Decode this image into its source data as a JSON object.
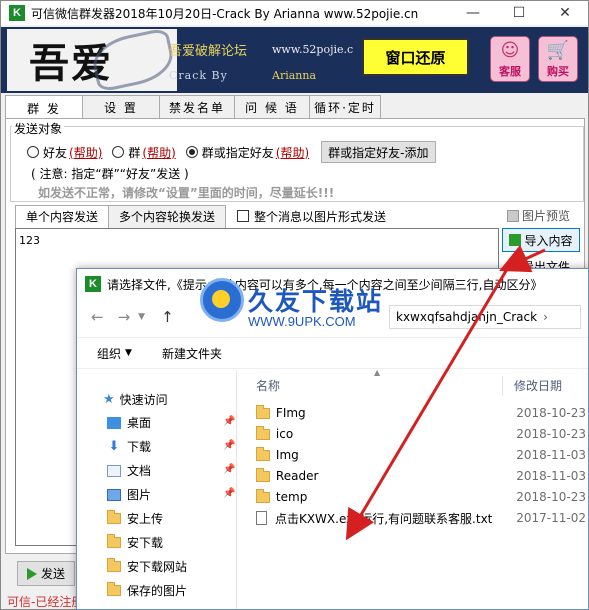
{
  "window": {
    "title": "可信微信群发器2018年10月20日-Crack By Arianna www.52pojie.cn",
    "icon_letter": "K",
    "controls": [
      "minimize-icon",
      "maximize-icon",
      "close-icon"
    ]
  },
  "banner": {
    "logo_glyph": "吾爱",
    "site_name": "吾爱破解论坛",
    "url": "www.52pojie.c",
    "crack_by": "Crack By",
    "author": "Arianna",
    "restore_button": "窗口还原",
    "service_button": "客服",
    "buy_button": "购买"
  },
  "tabs": [
    "群 发",
    "设 置",
    "禁发名单",
    "问 候 语",
    "循环·定时"
  ],
  "active_tab": 0,
  "send_target": {
    "group_label": "发送对象",
    "options": [
      {
        "label": "好友",
        "help": "(帮助)",
        "selected": false
      },
      {
        "label": "群",
        "help": "(帮助)",
        "selected": false
      },
      {
        "label": "群或指定好友",
        "help": "(帮助)",
        "selected": true
      }
    ],
    "add_button": "群或指定好友-添加",
    "note": "( 注意: 指定“群”“好友”发送 )",
    "warning": "如发送不正常，请修改“设置”里面的时间，尽量延长!!!"
  },
  "content": {
    "subtabs": [
      "单个内容发送",
      "多个内容轮换发送"
    ],
    "checkbox_label": "整个消息以图片形式发送",
    "text_value": "123",
    "preview_label": "图片预览",
    "import_button": "导入内容",
    "export_button": "导出文件"
  },
  "bottom": {
    "send_button": "发送",
    "status": "可信-已经注册"
  },
  "dialog": {
    "icon_letter": "K",
    "title": "请选择文件,《提示:文件内容可以有多个,每一个内容之间至少间隔三行,自动区分》",
    "address": "kxwxqfsahdjanjn_Crack",
    "organize": "组织",
    "new_folder": "新建文件夹",
    "quick_access": "快速访问",
    "nav_items": [
      "桌面",
      "下载",
      "文档",
      "图片",
      "安上传",
      "安下载",
      "安下载网站",
      "保存的图片"
    ],
    "columns": {
      "name": "名称",
      "modified": "修改日期"
    },
    "files": [
      {
        "name": "FImg",
        "date": "2018-10-23",
        "type": "folder"
      },
      {
        "name": "ico",
        "date": "2018-10-23",
        "type": "folder"
      },
      {
        "name": "Img",
        "date": "2018-11-03",
        "type": "folder"
      },
      {
        "name": "Reader",
        "date": "2018-11-03",
        "type": "folder"
      },
      {
        "name": "temp",
        "date": "2018-10-23",
        "type": "folder"
      },
      {
        "name": "点击KXWX.exe运行,有问题联系客服.txt",
        "date": "2017-11-02",
        "type": "txt"
      }
    ]
  },
  "watermark": {
    "brand": "久友下载站",
    "url": "WWW.9UPK.COM"
  },
  "colors": {
    "banner_bg": "#1a2f5a",
    "restore_bg": "#ffff33",
    "accent_red": "#d03030",
    "help_red": "#b00000",
    "arrow_red": "#d42020",
    "watermark_blue": "#1d58c0"
  }
}
